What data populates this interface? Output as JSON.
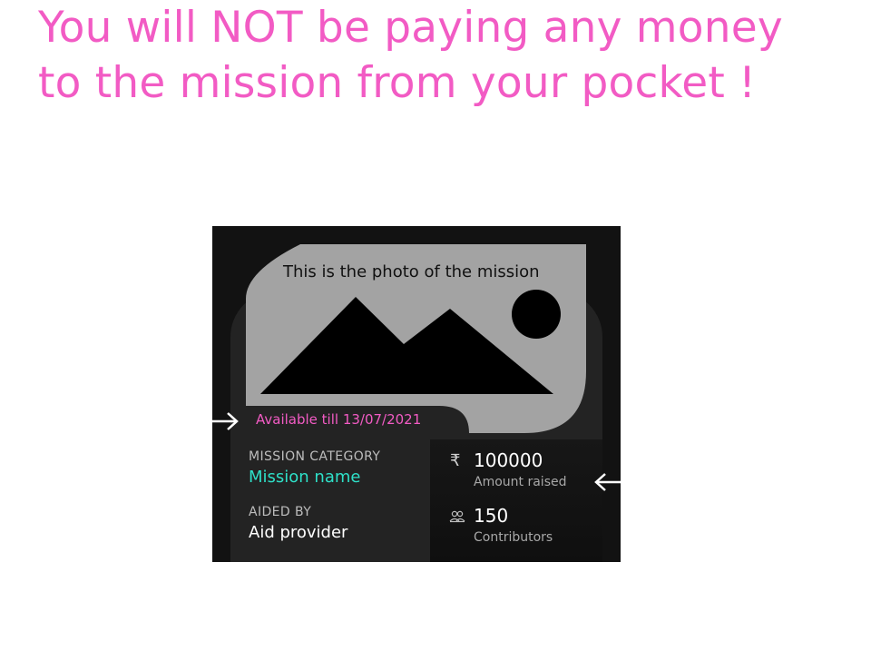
{
  "headline": {
    "line1": "You will NOT be paying any money",
    "line2": "to the mission from your pocket !"
  },
  "card": {
    "photo_caption": "This is the photo of the mission",
    "available_text": "Available till 13/07/2021",
    "category_label": "MISSION CATEGORY",
    "mission_name": "Mission name",
    "aided_by_label": "AIDED BY",
    "aid_provider": "Aid provider",
    "amount_symbol": "₹",
    "amount_value": "100000",
    "amount_label": "Amount raised",
    "contributors_value": "150",
    "contributors_label": "Contributors"
  },
  "colors": {
    "accent_pink": "#f25bc4",
    "accent_teal": "#2ee0c8",
    "photo_gray": "#a3a3a3"
  },
  "icons": [
    "arrow-right-icon",
    "arrow-left-icon",
    "rupee-icon",
    "people-icon",
    "mountain-image-icon"
  ]
}
